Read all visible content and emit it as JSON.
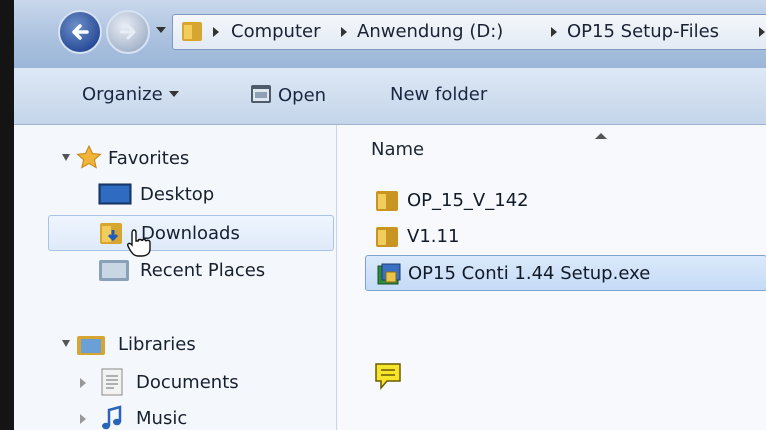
{
  "breadcrumb": {
    "items": [
      "Computer",
      "Anwendung (D:)",
      "OP15 Setup-Files"
    ]
  },
  "toolbar": {
    "organize_label": "Organize",
    "open_label": "Open",
    "new_folder_label": "New folder"
  },
  "nav": {
    "favorites_label": "Favorites",
    "desktop_label": "Desktop",
    "downloads_label": "Downloads",
    "recent_label": "Recent Places",
    "libraries_label": "Libraries",
    "documents_label": "Documents",
    "music_label": "Music"
  },
  "content": {
    "column_name": "Name",
    "files": [
      {
        "name": "OP_15_V_142",
        "icon": "folder-icon"
      },
      {
        "name": "V1.11",
        "icon": "folder-icon"
      },
      {
        "name": "OP15 Conti 1.44 Setup.exe",
        "icon": "setup-exe-icon"
      }
    ]
  },
  "colors": {
    "selection": "#c5dbf6",
    "toolbar": "#c4d5ea",
    "accent": "#2b4f9a"
  }
}
